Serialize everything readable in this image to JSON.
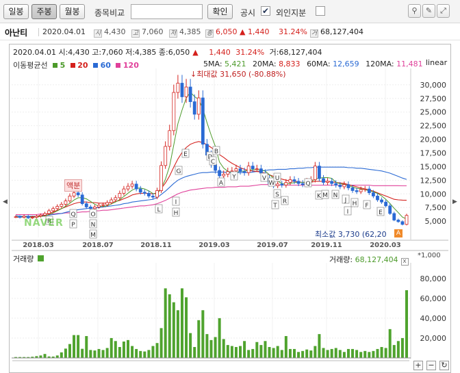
{
  "toolbar": {
    "daily": "일봉",
    "weekly": "주봉",
    "monthly": "월봉",
    "compare_label": "종목비교",
    "confirm": "확인",
    "notice_label": "공시",
    "foreign_label": "외인지분",
    "notice_checked": "✔",
    "search_value": ""
  },
  "info": {
    "name": "아난티",
    "date": "2020.04.01",
    "open_badge": "시",
    "open": "4,430",
    "high_badge": "고",
    "high": "7,060",
    "low_badge": "저",
    "low": "4,385",
    "close_badge": "종",
    "close": "6,050",
    "change": "▲ 1,440",
    "change_pct": "31.24%",
    "volume_badge": "거",
    "volume": "68,127,404"
  },
  "header": {
    "line": "2020.04.01 시:4,430 고:7,060 저:4,385 종:6,050",
    "up_arrow": "▲",
    "change": "1,440",
    "pct": "31.24%",
    "vol": "거:68,127,404",
    "ma_title": "이동평균선",
    "ma_legend": [
      {
        "label": "5",
        "color": "#4c9a2a"
      },
      {
        "label": "20",
        "color": "#d4201c"
      },
      {
        "label": "60",
        "color": "#2a6ad4"
      },
      {
        "label": "120",
        "color": "#e0409a"
      }
    ],
    "ma_values": {
      "ma5_label": "5MA:",
      "ma5": "5,421",
      "ma20_label": "20MA:",
      "ma20": "8,833",
      "ma60_label": "60MA:",
      "ma60": "12,659",
      "ma120_label": "120MA:",
      "ma120": "11,481"
    },
    "scale": "linear"
  },
  "annotations": {
    "max_label": "최대값 31,650 (-80.88%)",
    "min_label": "최소값 3,730 (62,20",
    "warning": "액분",
    "naver": "NAVER"
  },
  "volume_panel": {
    "title": "거래량",
    "value_label": "거래량:",
    "value": "68,127,404",
    "unit": "*1,000",
    "close": "x"
  },
  "chart_data": {
    "type": "candlestick",
    "price_axis": {
      "ticks": [
        "30,000",
        "27,500",
        "25,000",
        "22,500",
        "20,000",
        "17,500",
        "15,000",
        "12,500",
        "10,000",
        "7,500",
        "5,000"
      ],
      "scale": "linear"
    },
    "volume_axis": {
      "ticks": [
        "80,000",
        "60,000",
        "40,000",
        "20,000"
      ]
    },
    "x_ticks": [
      "2018.03",
      "2018.07",
      "2018.11",
      "2019.03",
      "2019.07",
      "2019.11",
      "2020.03"
    ],
    "close": [
      5800,
      5700,
      5900,
      5600,
      5700,
      5900,
      6100,
      6400,
      6900,
      7300,
      7700,
      8100,
      8700,
      9600,
      10200,
      9800,
      8200,
      7600,
      7300,
      7600,
      7900,
      8000,
      8400,
      8900,
      9300,
      10100,
      10900,
      11400,
      11800,
      10900,
      10300,
      10100,
      9600,
      9400,
      10600,
      15200,
      18700,
      21600,
      28600,
      30300,
      27800,
      29600,
      26900,
      24600,
      27600,
      19100,
      17100,
      15400,
      14300,
      13300,
      13600,
      14100,
      14200,
      14600,
      14100,
      13900,
      15100,
      14600,
      14600,
      13800,
      12800,
      11800,
      11500,
      11800,
      11600,
      12100,
      12600,
      12300,
      11900,
      11700,
      12300,
      12600,
      15100,
      12800,
      12100,
      12300,
      11900,
      11600,
      11300,
      11700,
      11100,
      10600,
      10400,
      10800,
      10900,
      10200,
      9600,
      8900,
      8500,
      7800,
      6400,
      5200,
      4900,
      4400,
      6050
    ],
    "ma20": [
      5700,
      5700,
      5800,
      5800,
      5800,
      5900,
      6000,
      6200,
      6400,
      6700,
      7000,
      7300,
      7600,
      7900,
      8200,
      8400,
      8500,
      8500,
      8400,
      8400,
      8300,
      8300,
      8300,
      8400,
      8600,
      8800,
      9100,
      9400,
      9800,
      10000,
      10100,
      10100,
      10100,
      10000,
      10200,
      11000,
      12000,
      13300,
      14900,
      16400,
      17600,
      18500,
      19100,
      19400,
      19600,
      19400,
      19000,
      18500,
      17900,
      17200,
      16700,
      16100,
      15600,
      15200,
      14800,
      14500,
      14300,
      14200,
      14100,
      14000,
      13800,
      13500,
      13200,
      12900,
      12700,
      12500,
      12400,
      12300,
      12200,
      12100,
      12100,
      12100,
      12300,
      12300,
      12300,
      12300,
      12200,
      12100,
      12000,
      11900,
      11700,
      11500,
      11300,
      11100,
      10900,
      10700,
      10500,
      10200,
      9900,
      9600,
      9300,
      9000,
      8900,
      8850,
      8833
    ],
    "ma60": [
      6000,
      5900,
      5900,
      5900,
      5900,
      5900,
      6000,
      6000,
      6100,
      6200,
      6300,
      6400,
      6600,
      6800,
      7000,
      7100,
      7200,
      7300,
      7400,
      7400,
      7500,
      7600,
      7700,
      7800,
      7900,
      8000,
      8200,
      8300,
      8500,
      8600,
      8700,
      8800,
      8900,
      9000,
      9300,
      9900,
      10500,
      11200,
      11900,
      12500,
      12900,
      13200,
      13400,
      13600,
      13800,
      13900,
      13900,
      14000,
      14000,
      14000,
      14000,
      13900,
      13900,
      13900,
      13900,
      13900,
      13900,
      14000,
      14100,
      14200,
      14300,
      14400,
      14400,
      14500,
      14500,
      14500,
      14600,
      14600,
      14700,
      14700,
      14800,
      14800,
      14900,
      14900,
      14900,
      14900,
      14900,
      14900,
      14900,
      14900,
      14800,
      14800,
      14700,
      14700,
      14600,
      14500,
      14400,
      14300,
      14200,
      14000,
      13800,
      13500,
      13200,
      12900,
      12659
    ],
    "ma120": [
      6200,
      6200,
      6200,
      6200,
      6200,
      6200,
      6300,
      6300,
      6300,
      6300,
      6400,
      6400,
      6500,
      6500,
      6600,
      6600,
      6700,
      6700,
      6800,
      6900,
      6900,
      7000,
      7000,
      7100,
      7200,
      7300,
      7400,
      7500,
      7600,
      7700,
      7800,
      7800,
      7900,
      8000,
      8200,
      8500,
      8800,
      9200,
      9600,
      10000,
      10300,
      10500,
      10700,
      10800,
      10900,
      11000,
      11100,
      11100,
      11200,
      11200,
      11200,
      11300,
      11300,
      11300,
      11400,
      11400,
      11400,
      11500,
      11600,
      11700,
      11700,
      11700,
      11700,
      11600,
      11600,
      11600,
      11600,
      11600,
      11600,
      11600,
      11600,
      11600,
      11600,
      11600,
      11600,
      11600,
      11600,
      11600,
      11600,
      11600,
      11600,
      11600,
      11600,
      11600,
      11600,
      11600,
      11500,
      11500,
      11500,
      11500,
      11500,
      11500,
      11500,
      11481,
      11481
    ],
    "volume": [
      900,
      900,
      900,
      900,
      1200,
      1800,
      2500,
      4000,
      1500,
      1400,
      2500,
      5600,
      9400,
      14000,
      23000,
      23000,
      9200,
      22000,
      8000,
      7500,
      9000,
      8000,
      10000,
      20000,
      17000,
      11000,
      16500,
      18000,
      12000,
      9000,
      7000,
      6500,
      8000,
      12000,
      15000,
      30000,
      70000,
      64000,
      56000,
      48000,
      70000,
      61000,
      25000,
      11000,
      38000,
      48000,
      24000,
      18000,
      21000,
      40000,
      19000,
      13000,
      12000,
      11000,
      12000,
      17000,
      8000,
      9000,
      16000,
      13000,
      17000,
      11000,
      10000,
      12000,
      8000,
      22000,
      9000,
      9000,
      6000,
      7000,
      8500,
      7500,
      12000,
      24000,
      10000,
      8000,
      9000,
      10000,
      8000,
      6000,
      9000,
      9000,
      8000,
      6000,
      7000,
      6000,
      7000,
      9000,
      11000,
      10000,
      29000,
      13000,
      17000,
      20000,
      68127
    ]
  }
}
